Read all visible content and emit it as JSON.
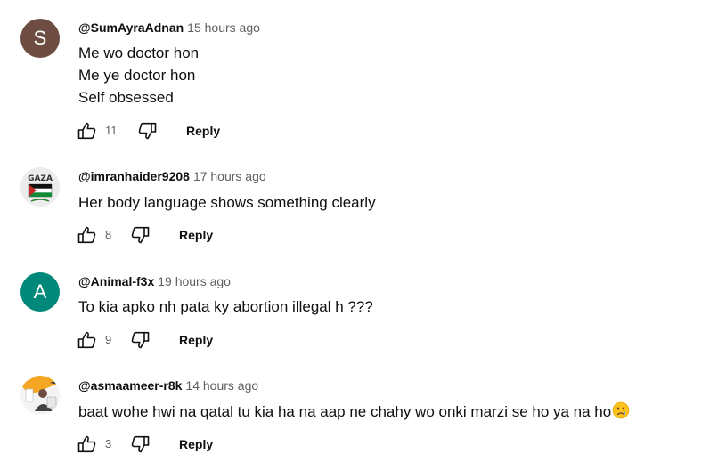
{
  "comments": [
    {
      "avatar_letter": "S",
      "avatar_color": "#6d4c41",
      "handle": "@SumAyraAdnan",
      "time": "15 hours ago",
      "lines": [
        "Me wo doctor hon",
        "Me ye doctor hon",
        "Self obsessed"
      ],
      "likes": "11",
      "reply_label": "Reply"
    },
    {
      "avatar_letter": "",
      "avatar_image_text": "GAZA",
      "handle": "@imranhaider9208",
      "time": "17 hours ago",
      "lines": [
        "Her body language shows something clearly"
      ],
      "likes": "8",
      "reply_label": "Reply"
    },
    {
      "avatar_letter": "A",
      "avatar_color": "#00897b",
      "handle": "@Animal-f3x",
      "time": "19 hours ago",
      "lines": [
        "To kia apko nh pata ky abortion illegal h ???"
      ],
      "likes": "9",
      "reply_label": "Reply"
    },
    {
      "avatar_letter": "",
      "handle": "@asmaameer-r8k",
      "time": "14 hours ago",
      "lines": [
        "baat wohe hwi na qatal tu kia ha na aap ne chahy wo onki marzi se ho ya na ho"
      ],
      "emoji": "crying-face",
      "likes": "3",
      "reply_label": "Reply"
    }
  ]
}
